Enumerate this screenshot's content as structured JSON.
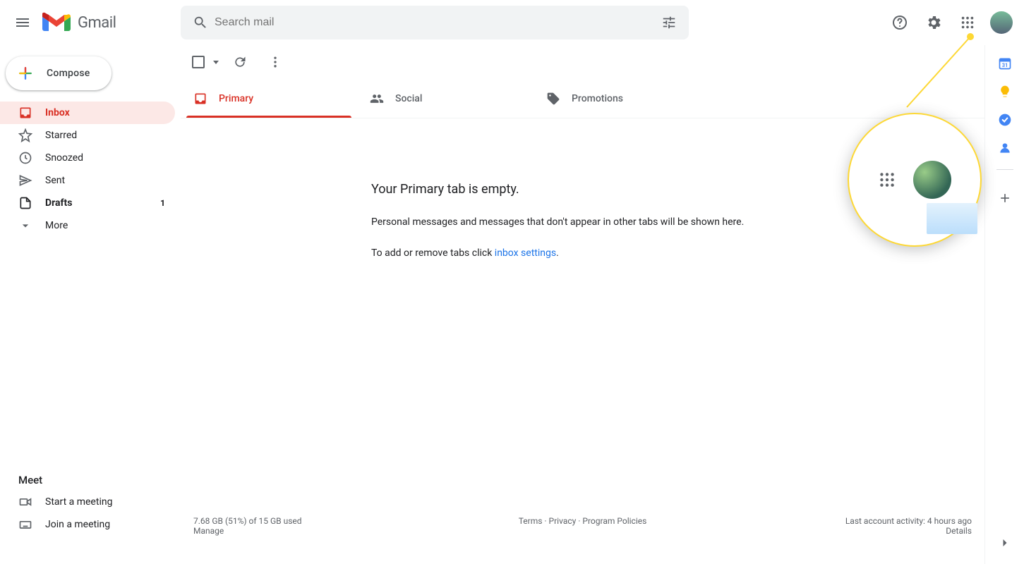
{
  "header": {
    "logo_text": "Gmail",
    "search_placeholder": "Search mail"
  },
  "sidebar": {
    "compose_label": "Compose",
    "items": [
      {
        "label": "Inbox",
        "count": "",
        "bold": true,
        "active": true,
        "icon": "inbox"
      },
      {
        "label": "Starred",
        "count": "",
        "bold": false,
        "active": false,
        "icon": "star"
      },
      {
        "label": "Snoozed",
        "count": "",
        "bold": false,
        "active": false,
        "icon": "clock"
      },
      {
        "label": "Sent",
        "count": "",
        "bold": false,
        "active": false,
        "icon": "send"
      },
      {
        "label": "Drafts",
        "count": "1",
        "bold": true,
        "active": false,
        "icon": "draft"
      },
      {
        "label": "More",
        "count": "",
        "bold": false,
        "active": false,
        "icon": "chevron-down"
      }
    ],
    "meet_header": "Meet",
    "meet_items": [
      {
        "label": "Start a meeting",
        "icon": "video"
      },
      {
        "label": "Join a meeting",
        "icon": "keyboard"
      }
    ]
  },
  "tabs": [
    {
      "label": "Primary",
      "active": true,
      "icon": "inbox-tab",
      "color": "#d93025"
    },
    {
      "label": "Social",
      "active": false,
      "icon": "people-tab",
      "color": "#5f6368"
    },
    {
      "label": "Promotions",
      "active": false,
      "icon": "tag-tab",
      "color": "#5f6368"
    }
  ],
  "empty": {
    "title": "Your Primary tab is empty.",
    "line1": "Personal messages and messages that don't appear in other tabs will be shown here.",
    "line2_pre": "To add or remove tabs click ",
    "line2_link": "inbox settings",
    "line2_post": "."
  },
  "footer": {
    "storage": "7.68 GB (51%) of 15 GB used",
    "manage": "Manage",
    "terms": "Terms",
    "privacy": "Privacy",
    "policies": "Program Policies",
    "activity": "Last account activity: 4 hours ago",
    "details": "Details"
  },
  "right_panel": {
    "icons": [
      "calendar",
      "keep",
      "tasks",
      "contacts"
    ]
  }
}
